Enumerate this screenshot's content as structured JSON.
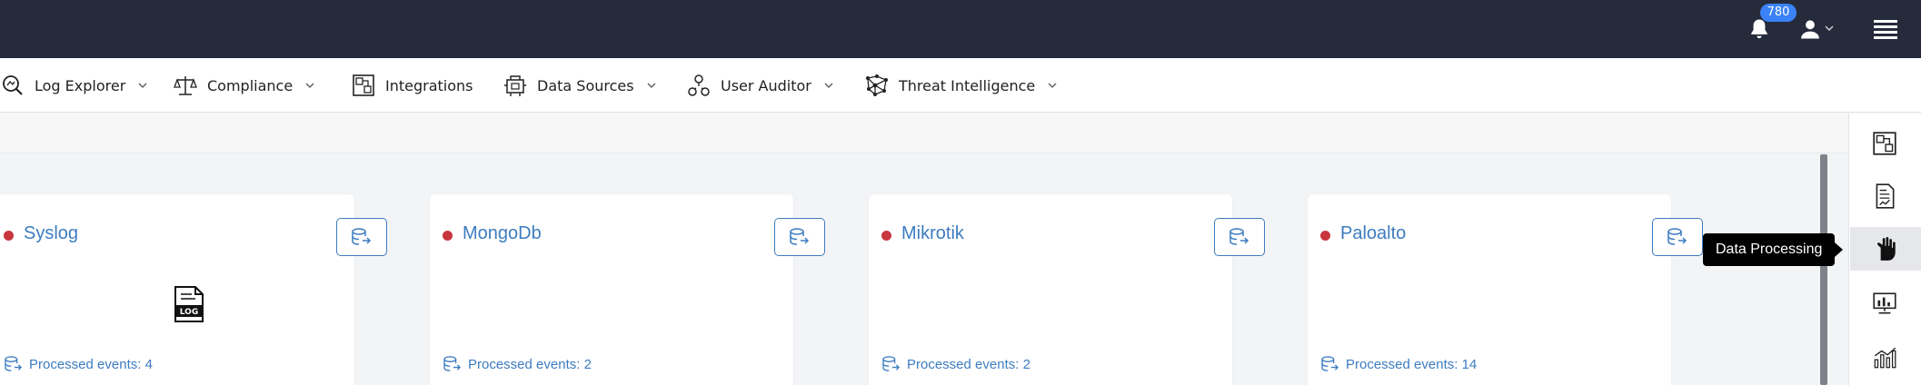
{
  "header": {
    "notifications_count": "780"
  },
  "nav": {
    "items": [
      {
        "label": "Log Explorer",
        "icon": "log-explorer-icon",
        "has_dropdown": true
      },
      {
        "label": "Compliance",
        "icon": "compliance-scale-icon",
        "has_dropdown": true
      },
      {
        "label": "Integrations",
        "icon": "integrations-icon",
        "has_dropdown": false
      },
      {
        "label": "Data Sources",
        "icon": "data-sources-icon",
        "has_dropdown": true
      },
      {
        "label": "User Auditor",
        "icon": "user-auditor-icon",
        "has_dropdown": true
      },
      {
        "label": "Threat Intelligence",
        "icon": "threat-intelligence-icon",
        "has_dropdown": true
      }
    ]
  },
  "rail": {
    "items": [
      {
        "icon": "integrations-icon"
      },
      {
        "icon": "report-icon"
      },
      {
        "icon": "data-processing-hand-icon",
        "active": true
      },
      {
        "icon": "monitor-chart-icon"
      },
      {
        "icon": "bar-chart-icon"
      }
    ],
    "tooltip": "Data Processing"
  },
  "cards": [
    {
      "name": "Syslog",
      "status_color": "#c8353e",
      "events_label": "Processed events: 4",
      "has_log_icon": true
    },
    {
      "name": "MongoDb",
      "status_color": "#c8353e",
      "events_label": "Processed events: 2",
      "has_log_icon": false
    },
    {
      "name": "Mikrotik",
      "status_color": "#c8353e",
      "events_label": "Processed events: 2",
      "has_log_icon": false
    },
    {
      "name": "Paloalto",
      "status_color": "#c8353e",
      "events_label": "Processed events: 14",
      "has_log_icon": false
    }
  ],
  "colors": {
    "topbar": "#252b3b",
    "accent": "#3d7cc0",
    "badge": "#3b82f6",
    "status_inactive": "#c8353e"
  }
}
